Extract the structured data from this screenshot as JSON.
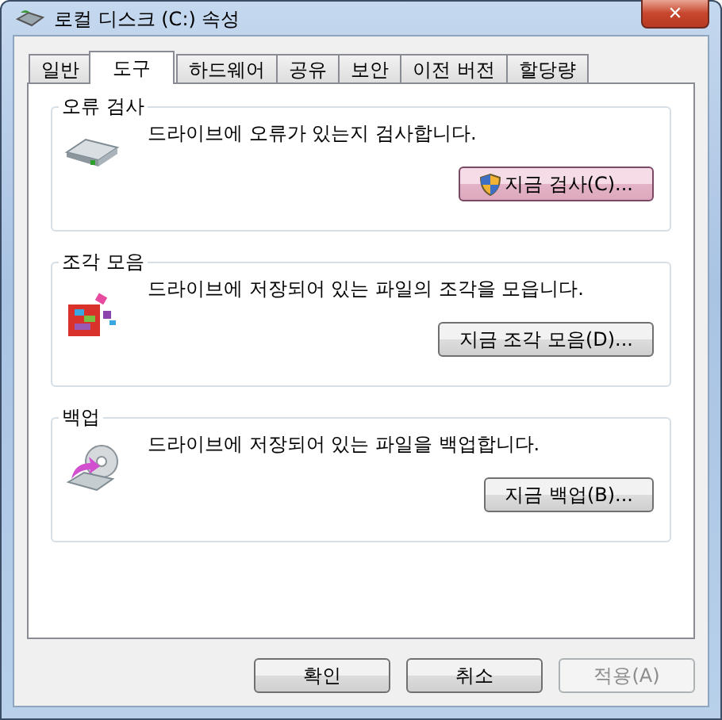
{
  "window": {
    "title": "로컬 디스크 (C:) 속성",
    "close": "✕"
  },
  "tabs": [
    {
      "label": "일반",
      "selected": false
    },
    {
      "label": "도구",
      "selected": true
    },
    {
      "label": "하드웨어",
      "selected": false
    },
    {
      "label": "공유",
      "selected": false
    },
    {
      "label": "보안",
      "selected": false
    },
    {
      "label": "이전 버전",
      "selected": false
    },
    {
      "label": "할당량",
      "selected": false
    }
  ],
  "sections": [
    {
      "kind": "check",
      "title": "오류 검사",
      "description": "드라이브에 오류가 있는지 검사합니다.",
      "button": {
        "label": "지금 검사(C)...",
        "shield": true,
        "hover": true
      }
    },
    {
      "kind": "defrag",
      "title": "조각 모음",
      "description": "드라이브에 저장되어 있는 파일의 조각을 모읍니다.",
      "button": {
        "label": "지금 조각 모음(D)...",
        "shield": false,
        "hover": false
      }
    },
    {
      "kind": "backup",
      "title": "백업",
      "description": "드라이브에 저장되어 있는 파일을 백업합니다.",
      "button": {
        "label": "지금 백업(B)...",
        "shield": false,
        "hover": false
      }
    }
  ],
  "buttons": [
    {
      "label": "확인",
      "disabled": false
    },
    {
      "label": "취소",
      "disabled": false
    },
    {
      "label": "적용(A)",
      "disabled": true
    }
  ]
}
